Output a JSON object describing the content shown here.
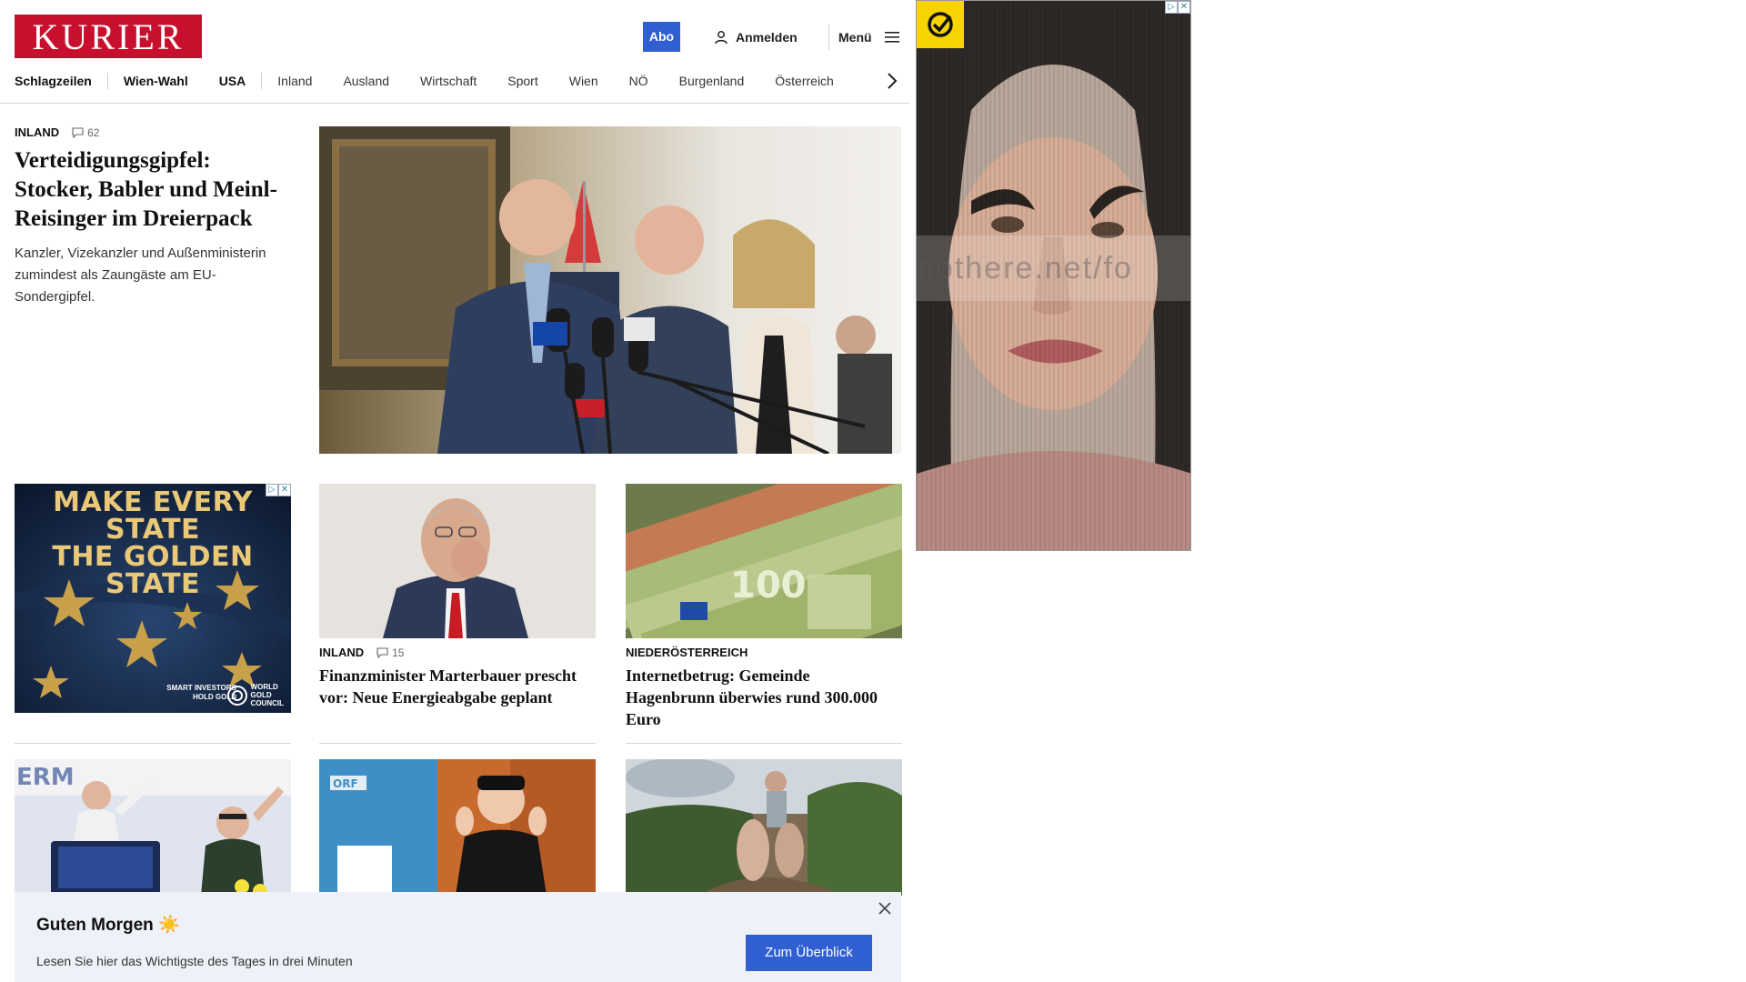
{
  "header": {
    "logo": "KURIER",
    "abo_label": "Abo",
    "login_label": "Anmelden",
    "menu_label": "Menü"
  },
  "nav": {
    "items": [
      "Schlagzeilen",
      "Wien-Wahl",
      "USA",
      "Inland",
      "Ausland",
      "Wirtschaft",
      "Sport",
      "Wien",
      "NÖ",
      "Burgenland",
      "Österreich"
    ]
  },
  "lead": {
    "category": "INLAND",
    "comments": "62",
    "title": "Verteidigungsgipfel: Stocker, Babler und Meinl-Reisinger im Dreierpack",
    "teaser": "Kanzler, Vizekanzler und Außenministerin zumindest als Zaungäste am EU-Sondergipfel."
  },
  "ad_golden": {
    "headline_line1": "MAKE EVERY STATE",
    "headline_line2": "THE GOLDEN STATE",
    "tagline_line1": "SMART INVESTORS",
    "tagline_line2": "HOLD GOLD",
    "brand_line1": "WORLD",
    "brand_line2": "GOLD",
    "brand_line3": "COUNCIL"
  },
  "cards": [
    {
      "category": "INLAND",
      "comments": "15",
      "title": "Finanzminister Marterbauer prescht vor: Neue Energieabgabe geplant"
    },
    {
      "category": "NIEDERÖSTERREICH",
      "title": "Internetbetrug: Gemeinde Hagenbrunn überwies rund 300.000 Euro"
    }
  ],
  "ad_portrait": {
    "watermark": "nothere.net/fo"
  },
  "morning": {
    "title": "Guten Morgen ☀️",
    "subtitle": "Lesen Sie hier das Wichtigste des Tages in drei Minuten",
    "cta_label": "Zum Überblick"
  },
  "colors": {
    "brand_red": "#c8102e",
    "accent_blue": "#2f5fd0"
  }
}
